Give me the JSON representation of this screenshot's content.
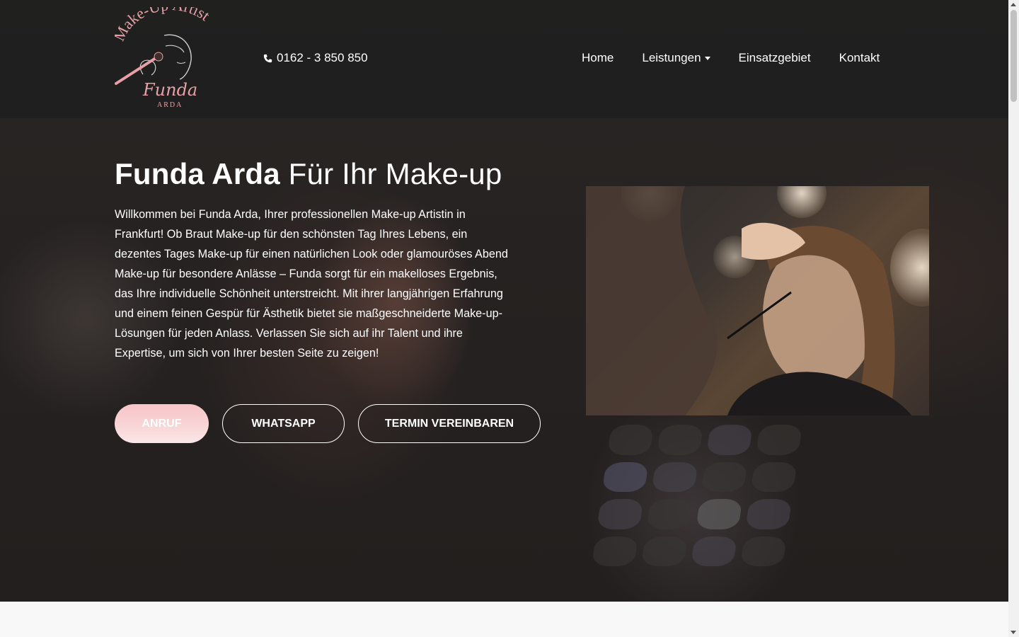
{
  "header": {
    "logo": {
      "text_top": "Make-Up Artist",
      "text_script": "Funda",
      "text_bottom": "ARDA"
    },
    "phone": "0162 - 3 850 850",
    "nav": [
      {
        "label": "Home"
      },
      {
        "label": "Leistungen"
      },
      {
        "label": "Einsatzgebiet"
      },
      {
        "label": "Kontakt"
      }
    ]
  },
  "hero": {
    "title_bold": "Funda Arda",
    "title_light": "Für Ihr Make-up",
    "text": "Willkommen bei Funda Arda, Ihrer professionellen Make-up Artistin in Frankfurt! Ob Braut Make-up für den schönsten Tag Ihres Lebens, ein dezentes Tages Make-up für einen natürlichen Look oder glamouröses Abend Make-up für besondere Anlässe – Funda sorgt für ein makelloses Ergebnis, das Ihre individuelle Schönheit unterstreicht. Mit ihrer langjährigen Erfahrung und einem feinen Gespür für Ästhetik bietet sie maßgeschneiderte Make-up-Lösungen für jeden Anlass. Verlassen Sie sich auf ihr Talent und ihre Expertise, um sich von Ihrer besten Seite zu zeigen!",
    "buttons": {
      "call": "Anruf",
      "whatsapp": "WhatsApp",
      "termin": "Termin vereinbaren"
    }
  },
  "colors": {
    "accent_pink": "#f7c4c8",
    "logo_pink": "#e8a0a6",
    "header_bg": "#1e1e1e"
  }
}
